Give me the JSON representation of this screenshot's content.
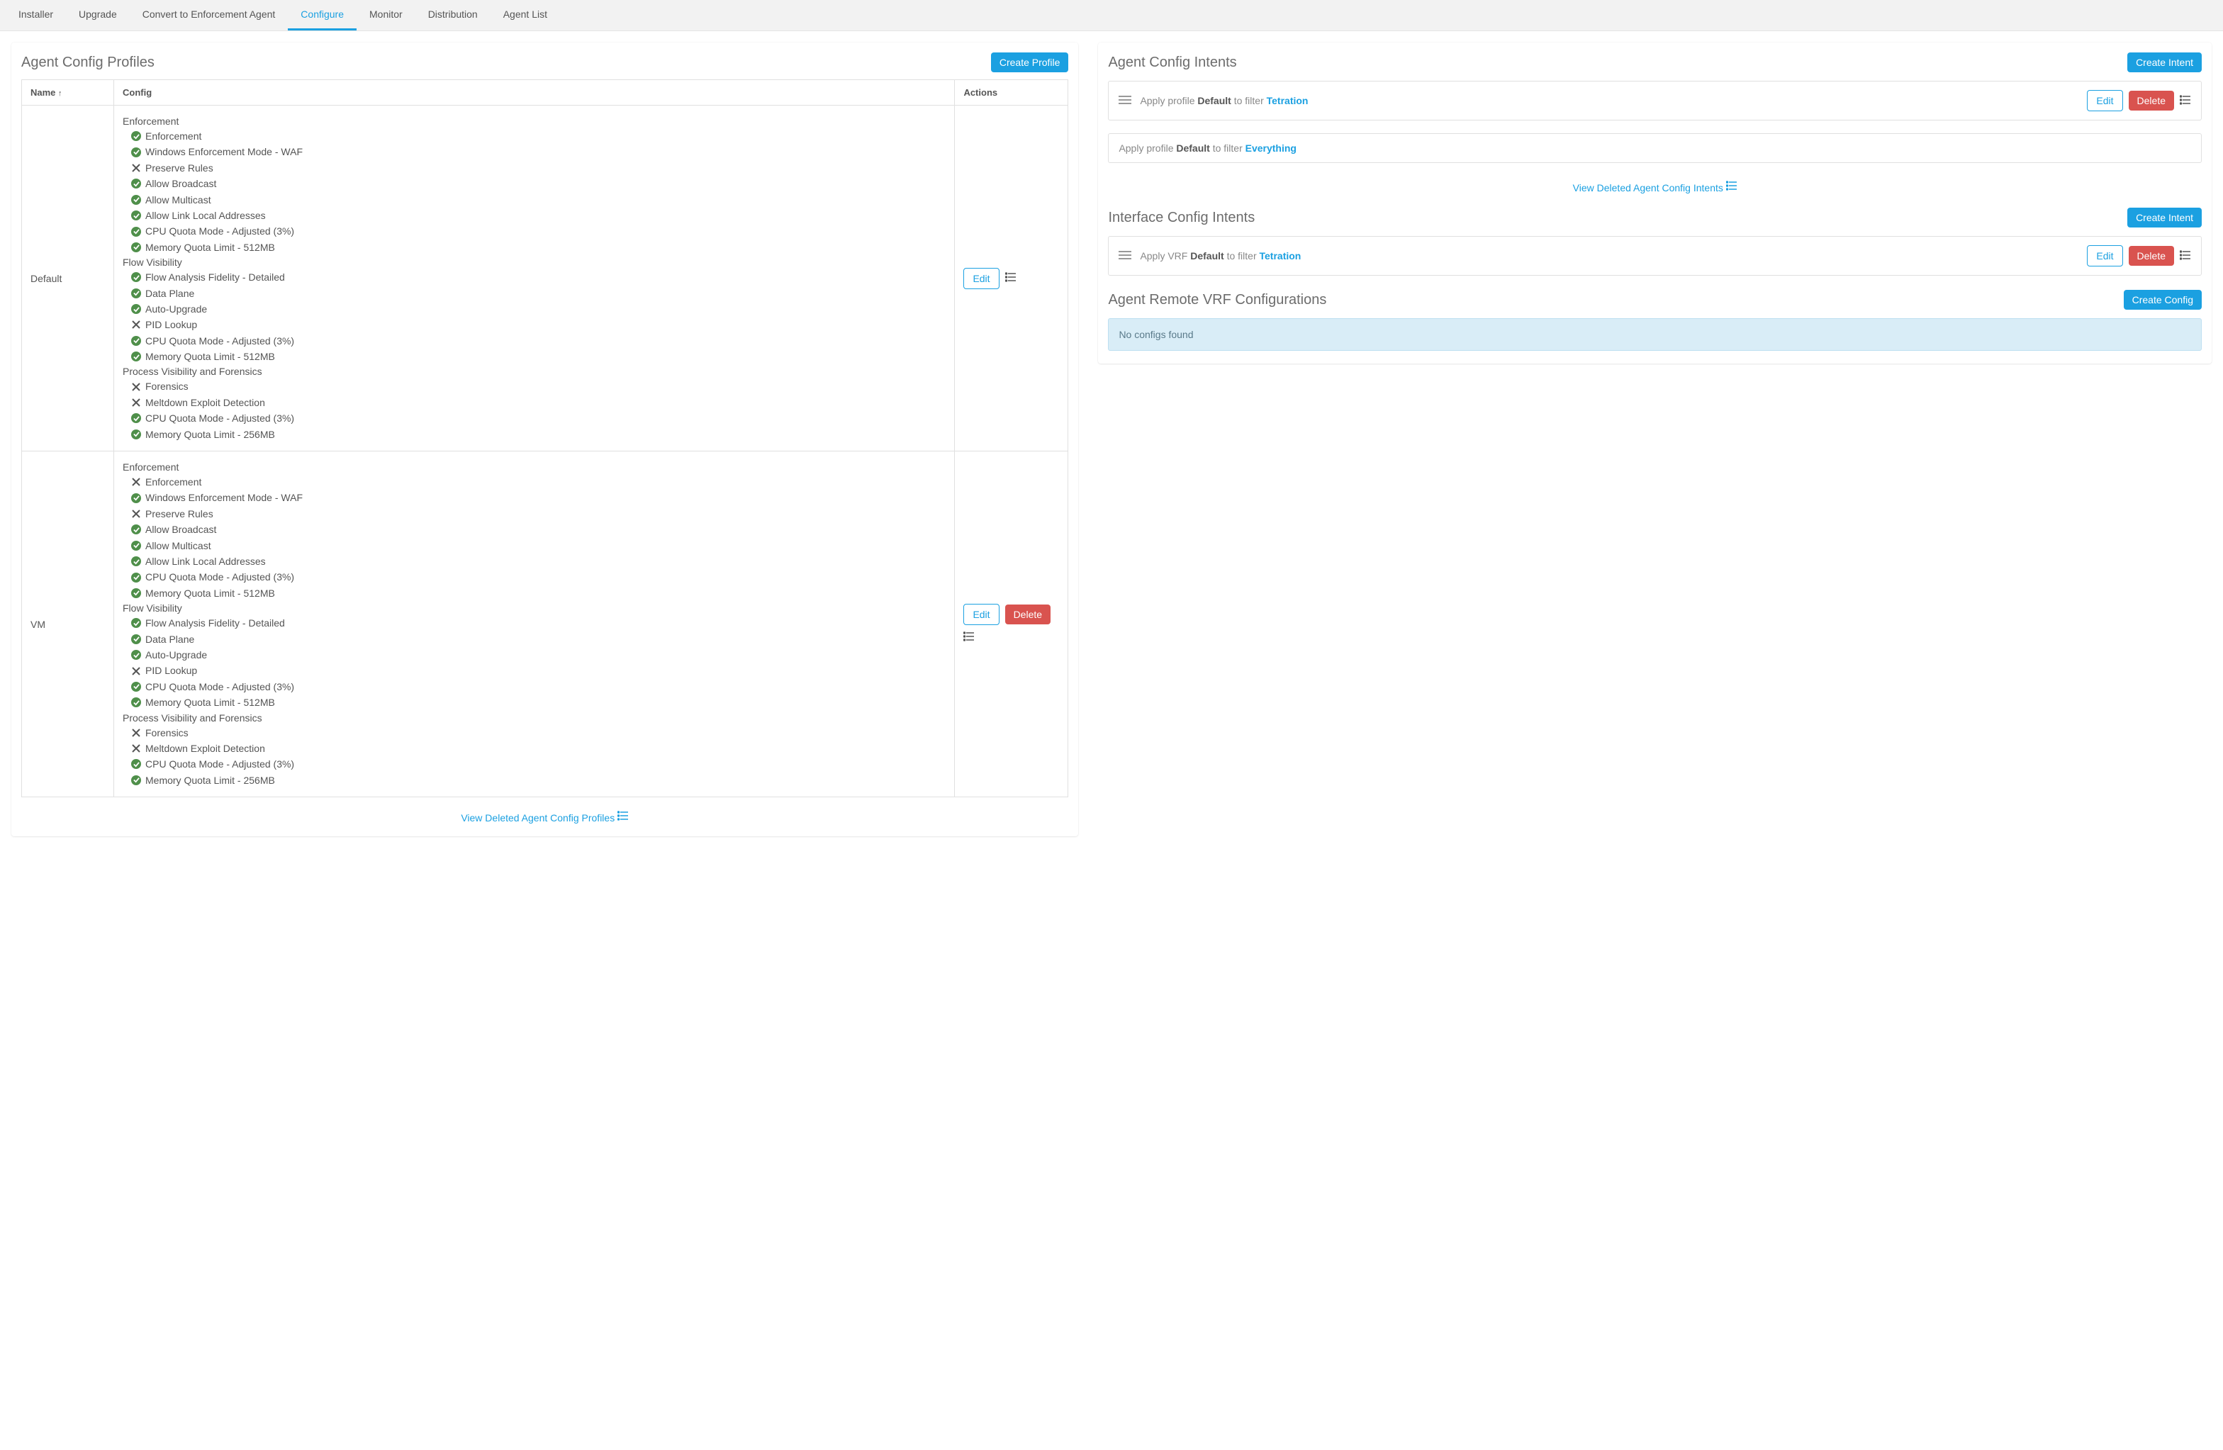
{
  "tabs": [
    "Installer",
    "Upgrade",
    "Convert to Enforcement Agent",
    "Configure",
    "Monitor",
    "Distribution",
    "Agent List"
  ],
  "active_tab": 3,
  "left": {
    "title": "Agent Config Profiles",
    "create_btn": "Create Profile",
    "th_name": "Name",
    "th_config": "Config",
    "th_actions": "Actions",
    "edit": "Edit",
    "delete": "Delete",
    "deleted_link": "View Deleted Agent Config Profiles",
    "profiles": [
      {
        "name": "Default",
        "can_delete": false,
        "sections": [
          {
            "title": "Enforcement",
            "items": [
              {
                "ok": true,
                "text": "Enforcement"
              },
              {
                "ok": true,
                "text": "Windows Enforcement Mode - WAF"
              },
              {
                "ok": false,
                "text": "Preserve Rules"
              },
              {
                "ok": true,
                "text": "Allow Broadcast"
              },
              {
                "ok": true,
                "text": "Allow Multicast"
              },
              {
                "ok": true,
                "text": "Allow Link Local Addresses"
              },
              {
                "ok": true,
                "text": "CPU Quota Mode - Adjusted (3%)"
              },
              {
                "ok": true,
                "text": "Memory Quota Limit - 512MB"
              }
            ]
          },
          {
            "title": "Flow Visibility",
            "items": [
              {
                "ok": true,
                "text": "Flow Analysis Fidelity - Detailed"
              },
              {
                "ok": true,
                "text": "Data Plane"
              },
              {
                "ok": true,
                "text": "Auto-Upgrade"
              },
              {
                "ok": false,
                "text": "PID Lookup"
              },
              {
                "ok": true,
                "text": "CPU Quota Mode - Adjusted (3%)"
              },
              {
                "ok": true,
                "text": "Memory Quota Limit - 512MB"
              }
            ]
          },
          {
            "title": "Process Visibility and Forensics",
            "items": [
              {
                "ok": false,
                "text": "Forensics"
              },
              {
                "ok": false,
                "text": "Meltdown Exploit Detection"
              },
              {
                "ok": true,
                "text": "CPU Quota Mode - Adjusted (3%)"
              },
              {
                "ok": true,
                "text": "Memory Quota Limit - 256MB"
              }
            ]
          }
        ]
      },
      {
        "name": "VM",
        "can_delete": true,
        "sections": [
          {
            "title": "Enforcement",
            "items": [
              {
                "ok": false,
                "text": "Enforcement"
              },
              {
                "ok": true,
                "text": "Windows Enforcement Mode - WAF"
              },
              {
                "ok": false,
                "text": "Preserve Rules"
              },
              {
                "ok": true,
                "text": "Allow Broadcast"
              },
              {
                "ok": true,
                "text": "Allow Multicast"
              },
              {
                "ok": true,
                "text": "Allow Link Local Addresses"
              },
              {
                "ok": true,
                "text": "CPU Quota Mode - Adjusted (3%)"
              },
              {
                "ok": true,
                "text": "Memory Quota Limit - 512MB"
              }
            ]
          },
          {
            "title": "Flow Visibility",
            "items": [
              {
                "ok": true,
                "text": "Flow Analysis Fidelity - Detailed"
              },
              {
                "ok": true,
                "text": "Data Plane"
              },
              {
                "ok": true,
                "text": "Auto-Upgrade"
              },
              {
                "ok": false,
                "text": "PID Lookup"
              },
              {
                "ok": true,
                "text": "CPU Quota Mode - Adjusted (3%)"
              },
              {
                "ok": true,
                "text": "Memory Quota Limit - 512MB"
              }
            ]
          },
          {
            "title": "Process Visibility and Forensics",
            "items": [
              {
                "ok": false,
                "text": "Forensics"
              },
              {
                "ok": false,
                "text": "Meltdown Exploit Detection"
              },
              {
                "ok": true,
                "text": "CPU Quota Mode - Adjusted (3%)"
              },
              {
                "ok": true,
                "text": "Memory Quota Limit - 256MB"
              }
            ]
          }
        ]
      }
    ]
  },
  "right": {
    "config_intents": {
      "title": "Agent Config Intents",
      "create_btn": "Create Intent",
      "edit": "Edit",
      "delete": "Delete",
      "deleted_link": "View Deleted Agent Config Intents",
      "intents": [
        {
          "prefix": "Apply profile ",
          "profile": "Default",
          "mid": " to filter ",
          "filter": "Tetration",
          "editable": true,
          "draggable": true
        },
        {
          "prefix": "Apply profile ",
          "profile": "Default",
          "mid": " to filter ",
          "filter": "Everything",
          "editable": false,
          "draggable": false
        }
      ]
    },
    "iface_intents": {
      "title": "Interface Config Intents",
      "create_btn": "Create Intent",
      "edit": "Edit",
      "delete": "Delete",
      "intents": [
        {
          "prefix": "Apply VRF ",
          "profile": "Default",
          "mid": " to filter ",
          "filter": "Tetration",
          "editable": true,
          "draggable": true
        }
      ]
    },
    "remote_vrf": {
      "title": "Agent Remote VRF Configurations",
      "create_btn": "Create Config",
      "msg": "No configs found"
    }
  }
}
